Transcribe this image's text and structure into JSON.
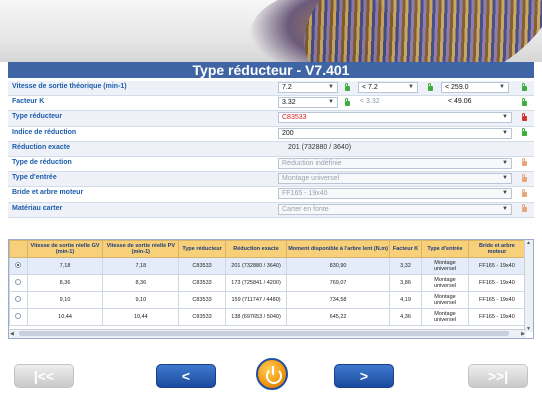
{
  "title": "Type réducteur - V7.401",
  "form": {
    "rows": [
      {
        "label": "Vitesse de sortie théorique (min-1)",
        "value": "7.2",
        "cmp1": "< 7.2",
        "cmp2": "< 259.0"
      },
      {
        "label": "Facteur K",
        "value": "3.32",
        "cmp1": "< 3.32",
        "cmp2": "< 49.06"
      },
      {
        "label": "Type réducteur",
        "value": "C83533"
      },
      {
        "label": "Indice de réduction",
        "value": "200"
      },
      {
        "label": "Réduction exacte",
        "value": "201 (732880 / 3640)"
      },
      {
        "label": "Type de réduction",
        "value": "Réduction indéfinie"
      },
      {
        "label": "Type d'entrée",
        "value": "Montage universel"
      },
      {
        "label": "Bride et arbre moteur",
        "value": "FF165 - 19x40"
      },
      {
        "label": "Matériau carter",
        "value": "Carter en fonte"
      }
    ]
  },
  "table": {
    "headers": [
      "Vitesse de sortie réelle GV (min-1)",
      "Vitesse de sortie réelle PV (min-1)",
      "Type réducteur",
      "Réduction exacte",
      "Moment disponible à l'arbre lent (N.m)",
      "Facteur K",
      "Type d'entrée",
      "Bride et arbre moteur"
    ],
    "rows": [
      {
        "c": [
          "7,18",
          "7,18",
          "C83533",
          "201 (732880 / 3640)",
          "830,90",
          "3,32",
          "Montage universel",
          "FF165 - 19x40"
        ],
        "selected": true
      },
      {
        "c": [
          "8,36",
          "8,36",
          "C83533",
          "173 (725841 / 4200)",
          "769,07",
          "3,86",
          "Montage universel",
          "FF165 - 19x40"
        ],
        "selected": false
      },
      {
        "c": [
          "9,10",
          "9,10",
          "C83533",
          "159 (711747 / 4480)",
          "734,58",
          "4,19",
          "Montage universel",
          "FF165 - 19x40"
        ],
        "selected": false
      },
      {
        "c": [
          "10,44",
          "10,44",
          "C83533",
          "138 (697653 / 5040)",
          "645,22",
          "4,36",
          "Montage universel",
          "FF165 - 19x40"
        ],
        "selected": false
      }
    ]
  },
  "nav": {
    "first": "|<<",
    "prev": "<",
    "next": ">",
    "last": ">>|"
  }
}
